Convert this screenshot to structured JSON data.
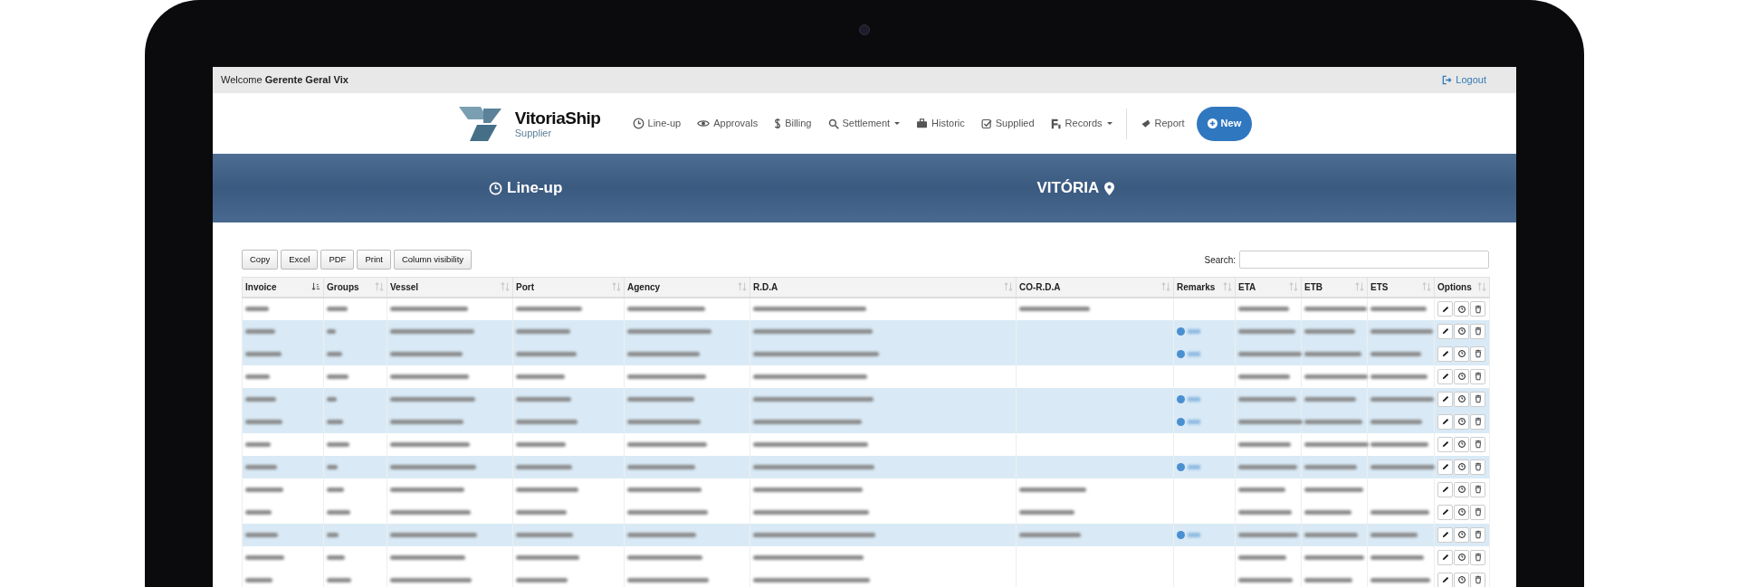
{
  "top_bar": {
    "welcome": "Welcome",
    "user": "Gerente Geral Vix",
    "logout": "Logout"
  },
  "brand": {
    "name": "VitoriaShip",
    "tagline": "Supplier"
  },
  "nav": [
    {
      "label": "Line-up",
      "dropdown": false
    },
    {
      "label": "Approvals",
      "dropdown": false
    },
    {
      "label": "Billing",
      "dropdown": false
    },
    {
      "label": "Settlement",
      "dropdown": true
    },
    {
      "label": "Historic",
      "dropdown": false
    },
    {
      "label": "Supplied",
      "dropdown": false
    },
    {
      "label": "Records",
      "dropdown": true
    },
    {
      "label": "Report",
      "dropdown": false
    }
  ],
  "new_button": "New",
  "banner": {
    "title": "Line-up",
    "location": "VITÓRIA"
  },
  "export_buttons": [
    "Copy",
    "Excel",
    "PDF",
    "Print",
    "Column visibility"
  ],
  "search": {
    "label": "Search:"
  },
  "table": {
    "columns": [
      {
        "label": "Invoice",
        "sorted": true
      },
      {
        "label": "Groups",
        "sorted": false
      },
      {
        "label": "Vessel",
        "sorted": false
      },
      {
        "label": "Port",
        "sorted": false
      },
      {
        "label": "Agency",
        "sorted": false
      },
      {
        "label": "R.D.A",
        "sorted": false
      },
      {
        "label": "CO-R.D.A",
        "sorted": false
      },
      {
        "label": "Remarks",
        "sorted": false
      },
      {
        "label": "ETA",
        "sorted": false
      },
      {
        "label": "ETB",
        "sorted": false
      },
      {
        "label": "ETS",
        "sorted": false
      },
      {
        "label": "Options",
        "sorted": false
      }
    ],
    "rows": [
      {
        "selected": false,
        "remark": false,
        "co_rda_shown": true,
        "ets_shown": true
      },
      {
        "selected": true,
        "remark": true,
        "co_rda_shown": false,
        "ets_shown": true
      },
      {
        "selected": true,
        "remark": true,
        "co_rda_shown": false,
        "ets_shown": true
      },
      {
        "selected": false,
        "remark": false,
        "co_rda_shown": false,
        "ets_shown": true
      },
      {
        "selected": true,
        "remark": true,
        "co_rda_shown": false,
        "ets_shown": true
      },
      {
        "selected": true,
        "remark": true,
        "co_rda_shown": false,
        "ets_shown": true
      },
      {
        "selected": false,
        "remark": false,
        "co_rda_shown": false,
        "ets_shown": true
      },
      {
        "selected": true,
        "remark": true,
        "co_rda_shown": false,
        "ets_shown": true
      },
      {
        "selected": false,
        "remark": false,
        "co_rda_shown": true,
        "ets_shown": false
      },
      {
        "selected": false,
        "remark": false,
        "co_rda_shown": true,
        "ets_shown": true
      },
      {
        "selected": true,
        "remark": true,
        "co_rda_shown": true,
        "ets_shown": true
      },
      {
        "selected": false,
        "remark": false,
        "co_rda_shown": false,
        "ets_shown": true
      },
      {
        "selected": false,
        "remark": false,
        "co_rda_shown": false,
        "ets_shown": true
      }
    ]
  }
}
